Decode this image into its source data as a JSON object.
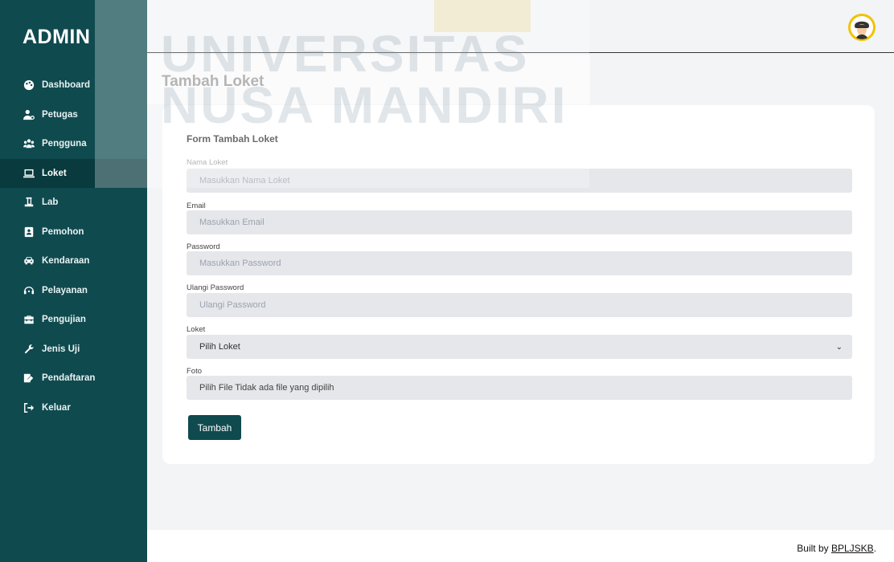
{
  "sidebar": {
    "brand": "ADMIN",
    "items": [
      {
        "label": "Dashboard",
        "icon": "palette-icon",
        "active": false
      },
      {
        "label": "Petugas",
        "icon": "user-tie-icon",
        "active": false
      },
      {
        "label": "Pengguna",
        "icon": "users-icon",
        "active": false
      },
      {
        "label": "Loket",
        "icon": "laptop-icon",
        "active": true
      },
      {
        "label": "Lab",
        "icon": "flask-icon",
        "active": false
      },
      {
        "label": "Pemohon",
        "icon": "address-book-icon",
        "active": false
      },
      {
        "label": "Kendaraan",
        "icon": "car-icon",
        "active": false
      },
      {
        "label": "Pelayanan",
        "icon": "headset-icon",
        "active": false
      },
      {
        "label": "Pengujian",
        "icon": "toolbox-icon",
        "active": false
      },
      {
        "label": "Jenis Uji",
        "icon": "wrench-icon",
        "active": false
      },
      {
        "label": "Pendaftaran",
        "icon": "signature-icon",
        "active": false
      },
      {
        "label": "Keluar",
        "icon": "sign-out-icon",
        "active": false
      }
    ]
  },
  "watermark": {
    "line1": "UNIVERSITAS",
    "line2": "NUSA MANDIRI"
  },
  "header": {
    "avatar": "user-avatar"
  },
  "main": {
    "title": "Tambah Loket",
    "form": {
      "title": "Form Tambah Loket",
      "fields": [
        {
          "label": "Nama Loket",
          "placeholder": "Masukkan Nama Loket"
        },
        {
          "label": "Email",
          "placeholder": "Masukkan Email"
        },
        {
          "label": "Password",
          "placeholder": "Masukkan Password"
        },
        {
          "label": "Ulangi Password",
          "placeholder": "Ulangi Password"
        }
      ],
      "loket": {
        "label": "Loket",
        "selected": "Pilih Loket"
      },
      "foto": {
        "label": "Foto",
        "value": "Pilih File Tidak ada file yang dipilih"
      },
      "submit": "Tambah"
    }
  },
  "footer": {
    "prefix": "Built by ",
    "link": "BPLJSKB",
    "suffix": "."
  },
  "colors": {
    "sidebar": "#0f4a4f",
    "accent": "#0f4a4f",
    "background": "#f3f4f6",
    "field": "#e5e7eb"
  }
}
